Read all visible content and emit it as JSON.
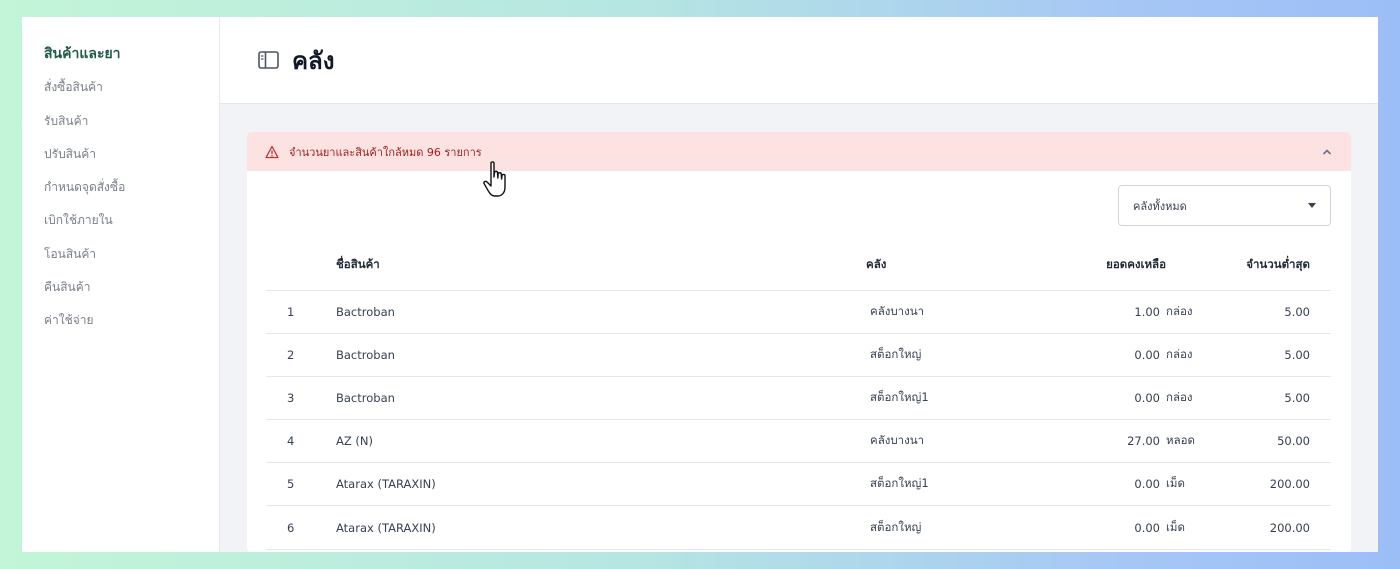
{
  "sidebar": {
    "items": [
      {
        "label": "สินค้าและยา",
        "active": true
      },
      {
        "label": "สั่งซื้อสินค้า"
      },
      {
        "label": "รับสินค้า"
      },
      {
        "label": "ปรับสินค้า"
      },
      {
        "label": "กำหนดจุดสั่งซื้อ"
      },
      {
        "label": "เบิกใช้ภายใน"
      },
      {
        "label": "โอนสินค้า"
      },
      {
        "label": "คืนสินค้า"
      },
      {
        "label": "ค่าใช้จ่าย"
      }
    ]
  },
  "header": {
    "title": "คลัง",
    "icon": "sidebar-toggle-icon"
  },
  "alert": {
    "text": "จำนวนยาและสินค้าใกล้หมด 96 รายการ",
    "icon": "warning-icon",
    "toggle_icon": "chevron-up-icon"
  },
  "filter": {
    "selected": "คลังทั้งหมด"
  },
  "table": {
    "headers": {
      "index": "",
      "name": "ชื่อสินค้า",
      "warehouse": "คลัง",
      "balance": "ยอดคงเหลือ",
      "unit": "",
      "min": "จำนวนต่ำสุด"
    },
    "rows": [
      {
        "index": "1",
        "name": "Bactroban",
        "warehouse": "คลังบางนา",
        "balance": "1.00",
        "unit": "กล่อง",
        "min": "5.00"
      },
      {
        "index": "2",
        "name": "Bactroban",
        "warehouse": "สต็อกใหญ่",
        "balance": "0.00",
        "unit": "กล่อง",
        "min": "5.00"
      },
      {
        "index": "3",
        "name": "Bactroban",
        "warehouse": "สต็อกใหญ่1",
        "balance": "0.00",
        "unit": "กล่อง",
        "min": "5.00"
      },
      {
        "index": "4",
        "name": "AZ (N)",
        "warehouse": "คลังบางนา",
        "balance": "27.00",
        "unit": "หลอด",
        "min": "50.00"
      },
      {
        "index": "5",
        "name": "Atarax (TARAXIN)",
        "warehouse": "สต็อกใหญ่1",
        "balance": "0.00",
        "unit": "เม็ด",
        "min": "200.00"
      },
      {
        "index": "6",
        "name": "Atarax (TARAXIN)",
        "warehouse": "สต็อกใหญ่",
        "balance": "0.00",
        "unit": "เม็ด",
        "min": "200.00"
      }
    ]
  },
  "colors": {
    "accent": "#1f5c46",
    "alert_bg": "#fde2e2",
    "alert_text": "#9f1d1d"
  }
}
